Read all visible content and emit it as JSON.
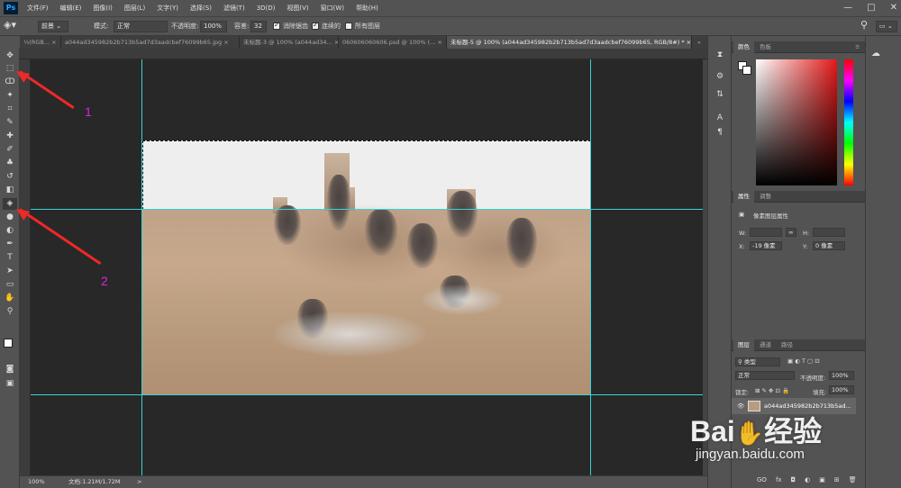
{
  "app": {
    "logo": "Ps"
  },
  "menu": [
    "文件(F)",
    "编辑(E)",
    "图像(I)",
    "图层(L)",
    "文字(Y)",
    "选择(S)",
    "滤镜(T)",
    "3D(D)",
    "视图(V)",
    "窗口(W)",
    "帮助(H)"
  ],
  "window_buttons": [
    "—",
    "□",
    "✕"
  ],
  "options": {
    "fill_source": "前景",
    "mode_label": "模式:",
    "mode_value": "正常",
    "opacity_label": "不透明度:",
    "opacity_value": "100%",
    "tolerance_label": "容差:",
    "tolerance_value": "32",
    "antialias_label": "消除锯齿",
    "contiguous_label": "连续的",
    "all_layers_label": "所有图层"
  },
  "tabs": [
    {
      "label": "⅓(RGB...",
      "close": "×"
    },
    {
      "label": "a044ad345982b2b713b5ad7d3aadcbef76099b65.jpg",
      "close": "×"
    },
    {
      "label": "未标题-3 @ 100% (a044ad34...",
      "close": "×"
    },
    {
      "label": "060606060606.psd @ 100% (...",
      "close": "×"
    },
    {
      "label": "未标题-5 @ 100% (a044ad345982b2b713b5ad7d3aadcbef76099b65, RGB/8#) *",
      "close": "×",
      "active": true
    }
  ],
  "tabs_overflow": "»",
  "toolbar": [
    {
      "icon": "move-icon",
      "glyph": "✥"
    },
    {
      "icon": "rect-marquee-icon",
      "glyph": "⬚"
    },
    {
      "icon": "lasso-icon",
      "glyph": "ↀ"
    },
    {
      "icon": "magic-wand-icon",
      "glyph": "✦"
    },
    {
      "icon": "crop-icon",
      "glyph": "⌗"
    },
    {
      "icon": "eyedropper-icon",
      "glyph": "✎"
    },
    {
      "icon": "healing-brush-icon",
      "glyph": "✚"
    },
    {
      "icon": "brush-icon",
      "glyph": "✐"
    },
    {
      "icon": "clone-stamp-icon",
      "glyph": "♣"
    },
    {
      "icon": "history-brush-icon",
      "glyph": "↺"
    },
    {
      "icon": "eraser-icon",
      "glyph": "◧"
    },
    {
      "icon": "paint-bucket-icon",
      "glyph": "◈"
    },
    {
      "icon": "blur-icon",
      "glyph": "●"
    },
    {
      "icon": "dodge-icon",
      "glyph": "◐"
    },
    {
      "icon": "pen-icon",
      "glyph": "✒"
    },
    {
      "icon": "type-icon",
      "glyph": "T"
    },
    {
      "icon": "path-select-icon",
      "glyph": "➤"
    },
    {
      "icon": "shape-icon",
      "glyph": "▭"
    },
    {
      "icon": "hand-icon",
      "glyph": "✋"
    },
    {
      "icon": "zoom-icon",
      "glyph": "⚲"
    }
  ],
  "status": {
    "zoom": "100%",
    "doc": "文档:1.21M/1.72M",
    "arrow": ">"
  },
  "annotations": [
    "1",
    "2"
  ],
  "color_panel": {
    "tabs": [
      "颜色",
      "色板"
    ]
  },
  "properties_panel": {
    "tabs": [
      "属性",
      "调整"
    ],
    "title": "像素图层属性",
    "w_label": "W:",
    "h_label": "H:",
    "x_label": "X:",
    "x_value": "-19 像素",
    "y_label": "Y:",
    "y_value": "0 像素"
  },
  "layers_panel": {
    "tabs": [
      "图层",
      "通道",
      "路径"
    ],
    "filter_value": "类型",
    "blend_mode": "正常",
    "opacity_label": "不透明度:",
    "opacity_value": "100%",
    "lock_label": "锁定:",
    "fill_label": "填充:",
    "fill_value": "100%",
    "layer_name": "a044ad345982b2b713b5ad...",
    "footer_icons": [
      "GO",
      "fx",
      "◘",
      "◐",
      "▣",
      "⊞",
      "🗑"
    ]
  },
  "colors": {
    "panel_bg": "#535353",
    "canvas_bg": "#282828",
    "guide": "#3ad4d4",
    "arrow": "#ef2828",
    "annotation": "#e020e0"
  },
  "watermark": {
    "logo": "Bai",
    "logo_suffix": "经验",
    "url": "jingyan.baidu.com"
  }
}
